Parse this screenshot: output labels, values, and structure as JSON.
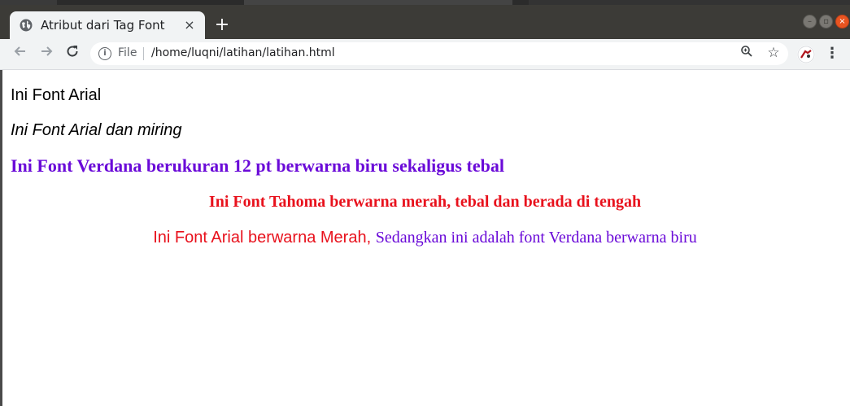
{
  "browser": {
    "tab_title": "Atribut dari Tag Font",
    "tab_close_glyph": "×",
    "new_tab_glyph": "+",
    "scheme_label": "File",
    "url": "/home/luqni/latihan/latihan.html",
    "icons": {
      "tab_favicon": "globe-icon",
      "back": "arrow-left-icon",
      "forward": "arrow-right-icon",
      "reload": "reload-icon",
      "info": "info-icon",
      "zoom": "zoom-icon",
      "bookmark": "star-icon",
      "extension": "extension-avatar-icon",
      "menu": "kebab-menu-icon"
    },
    "colors": {
      "tabbar": "#3c3b37",
      "toolbar": "#f1f3f4",
      "close_window": "#e95420"
    }
  },
  "page": {
    "line1": "Ini Font Arial",
    "line2": "Ini Font Arial dan miring",
    "line3": "Ini Font Verdana berukuran 12 pt berwarna biru sekaligus tebal",
    "line4": "Ini Font Tahoma berwarna merah, tebal dan berada di tengah",
    "line5_red": "Ini Font Arial berwarna Merah,",
    "line5_blue": "Sedangkan ini adalah font Verdana berwarna biru",
    "colors": {
      "blue": "#6a0ad8",
      "red": "#e8111c",
      "black": "#000000"
    }
  }
}
